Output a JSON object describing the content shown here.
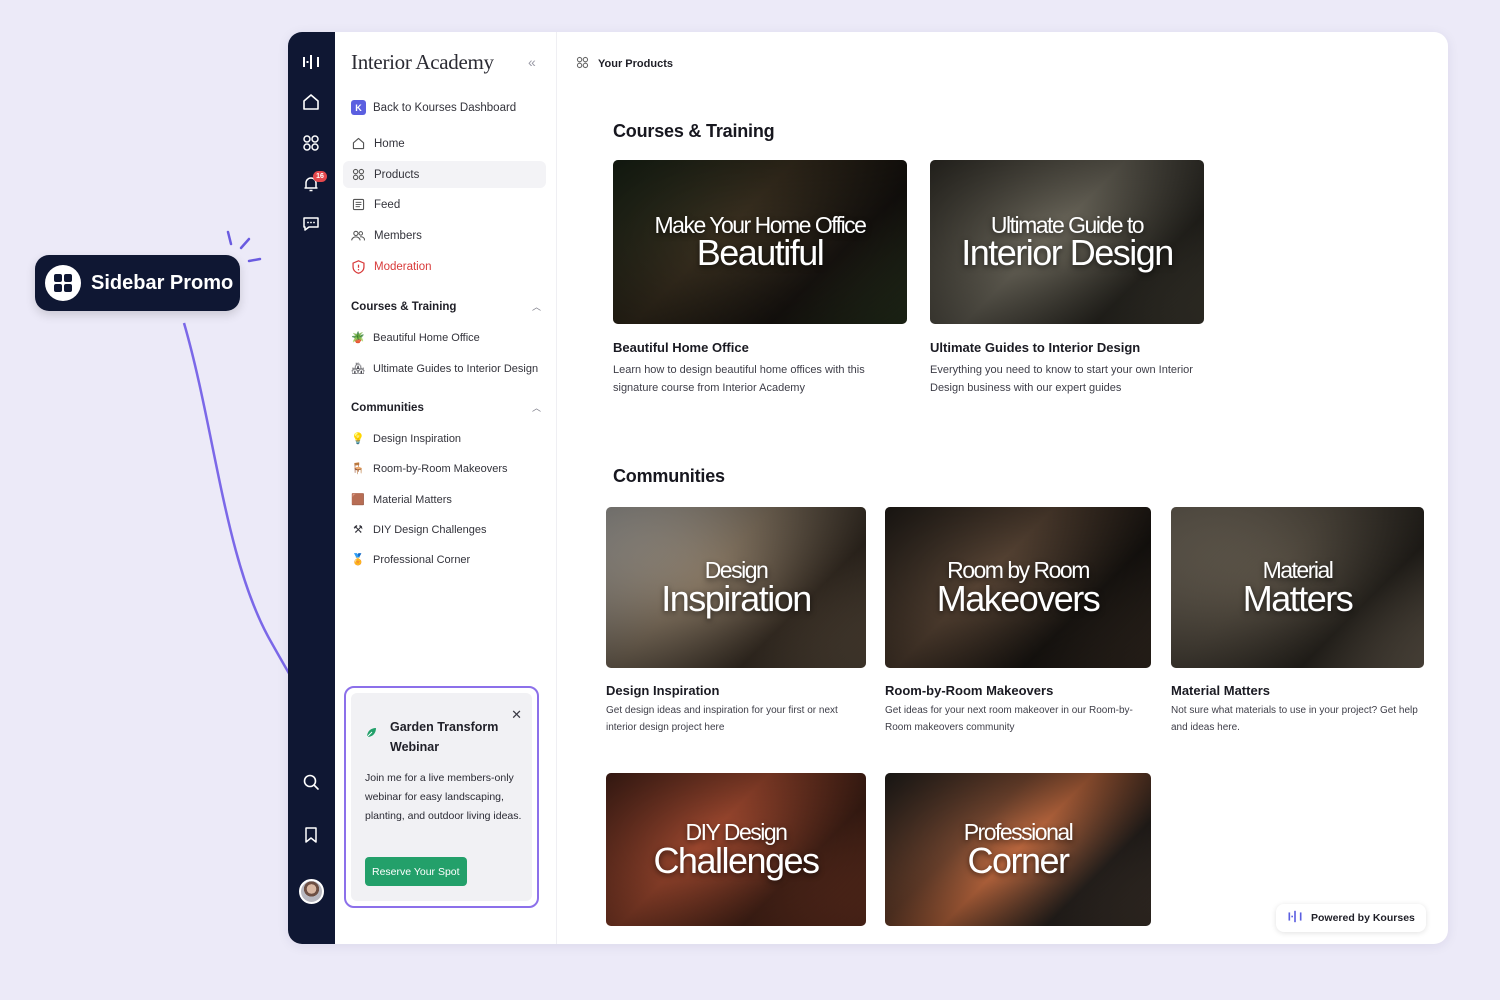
{
  "annotation": {
    "label": "Sidebar Promo"
  },
  "rail": {
    "notification_count": "16"
  },
  "sidebar": {
    "brand": "Interior Academy",
    "back_link": {
      "badge": "K",
      "label": "Back to Kourses Dashboard"
    },
    "nav": [
      {
        "label": "Home",
        "icon": "home-icon"
      },
      {
        "label": "Products",
        "icon": "grid-icon",
        "active": true
      },
      {
        "label": "Feed",
        "icon": "feed-icon"
      },
      {
        "label": "Members",
        "icon": "members-icon"
      },
      {
        "label": "Moderation",
        "icon": "shield-icon"
      }
    ],
    "courses_section": {
      "title": "Courses & Training",
      "items": [
        "Beautiful Home Office",
        "Ultimate Guides to Interior Design"
      ]
    },
    "communities_section": {
      "title": "Communities",
      "items": [
        "Design Inspiration",
        "Room-by-Room Makeovers",
        "Material Matters",
        "DIY Design Challenges",
        "Professional Corner"
      ]
    },
    "promo": {
      "title": "Garden Transform Webinar",
      "body": "Join me for a live members-only webinar for easy landscaping, planting, and outdoor living ideas.",
      "button": "Reserve Your Spot"
    }
  },
  "main": {
    "breadcrumb": "Your Products",
    "courses_heading": "Courses & Training",
    "courses": [
      {
        "thumb_line1": "Make Your Home Office",
        "thumb_line2": "Beautiful",
        "title": "Beautiful Home Office",
        "desc": "Learn how to design beautiful home offices with this signature course from Interior Academy"
      },
      {
        "thumb_line1": "Ultimate Guide to",
        "thumb_line2": "Interior Design",
        "title": "Ultimate Guides to Interior Design",
        "desc": "Everything you need to know to start your own Interior Design business with our expert guides"
      }
    ],
    "communities_heading": "Communities",
    "communities": [
      {
        "thumb_line1": "Design",
        "thumb_line2": "Inspiration",
        "title": "Design Inspiration",
        "desc": "Get design ideas and inspiration for your first or next interior design project here"
      },
      {
        "thumb_line1": "Room by Room",
        "thumb_line2": "Makeovers",
        "title": "Room-by-Room Makeovers",
        "desc": "Get ideas for your next room makeover in our Room-by-Room makeovers community"
      },
      {
        "thumb_line1": "Material",
        "thumb_line2": "Matters",
        "title": "Material Matters",
        "desc": "Not sure what materials to use in your project? Get help and ideas here."
      },
      {
        "thumb_line1": "DIY Design",
        "thumb_line2": "Challenges"
      },
      {
        "thumb_line1": "Professional",
        "thumb_line2": "Corner"
      }
    ],
    "powered_by": "Powered by Kourses"
  },
  "colors": {
    "rail": "#0f1733",
    "accent": "#5b5fe0",
    "promo_border": "#8c70ea",
    "promo_button": "#23a06a",
    "moderation": "#d83a3a"
  }
}
